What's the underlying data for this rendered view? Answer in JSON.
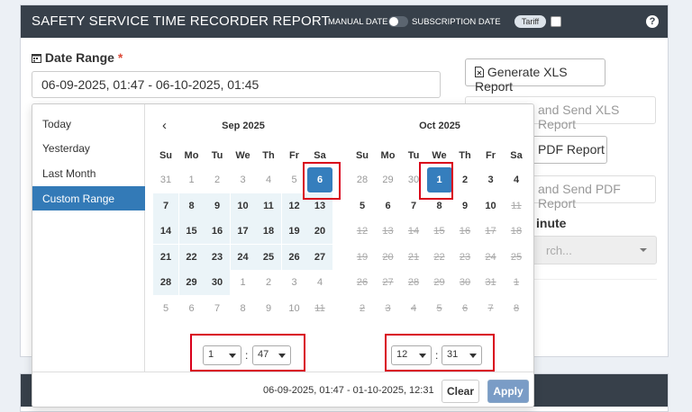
{
  "header": {
    "title": "SAFETY SERVICE TIME RECORDER REPORT",
    "manual_date": "MANUAL DATE",
    "subscription_date": "SUBSCRIPTION DATE",
    "tariff": "Tariff",
    "help": "?"
  },
  "form": {
    "date_range_label": "Date Range",
    "required_mark": "*",
    "date_range_value": "06-09-2025, 01:47 - 06-10-2025, 01:45",
    "minute_label": "inute",
    "select_placeholder": "rch..."
  },
  "buttons": {
    "generate_xls": "Generate XLS Report",
    "send_xls": "and Send XLS Report",
    "pdf": "PDF Report",
    "send_pdf": "and Send PDF Report"
  },
  "picker": {
    "ranges": [
      "Today",
      "Yesterday",
      "Last Month",
      "Custom Range"
    ],
    "active_range": "Custom Range",
    "dow": [
      "Su",
      "Mo",
      "Tu",
      "We",
      "Th",
      "Fr",
      "Sa"
    ],
    "left": {
      "month": "Sep 2025",
      "prev_label": "‹",
      "rows": [
        [
          "31",
          "1",
          "2",
          "3",
          "4",
          "5",
          "6"
        ],
        [
          "7",
          "8",
          "9",
          "10",
          "11",
          "12",
          "13"
        ],
        [
          "14",
          "15",
          "16",
          "17",
          "18",
          "19",
          "20"
        ],
        [
          "21",
          "22",
          "23",
          "24",
          "25",
          "26",
          "27"
        ],
        [
          "28",
          "29",
          "30",
          "1",
          "2",
          "3",
          "4"
        ],
        [
          "5",
          "6",
          "7",
          "8",
          "9",
          "10",
          "11"
        ]
      ],
      "hour": "1",
      "minute": "47"
    },
    "right": {
      "month": "Oct 2025",
      "rows": [
        [
          "28",
          "29",
          "30",
          "1",
          "2",
          "3",
          "4"
        ],
        [
          "5",
          "6",
          "7",
          "8",
          "9",
          "10",
          "11"
        ],
        [
          "12",
          "13",
          "14",
          "15",
          "16",
          "17",
          "18"
        ],
        [
          "19",
          "20",
          "21",
          "22",
          "23",
          "24",
          "25"
        ],
        [
          "26",
          "27",
          "28",
          "29",
          "30",
          "31",
          "1"
        ],
        [
          "2",
          "3",
          "4",
          "5",
          "6",
          "7",
          "8"
        ]
      ],
      "hour": "12",
      "minute": "31"
    },
    "selected_text": "06-09-2025, 01:47 - 01-10-2025, 12:31",
    "clear": "Clear",
    "apply": "Apply",
    "time_sep": ":"
  }
}
